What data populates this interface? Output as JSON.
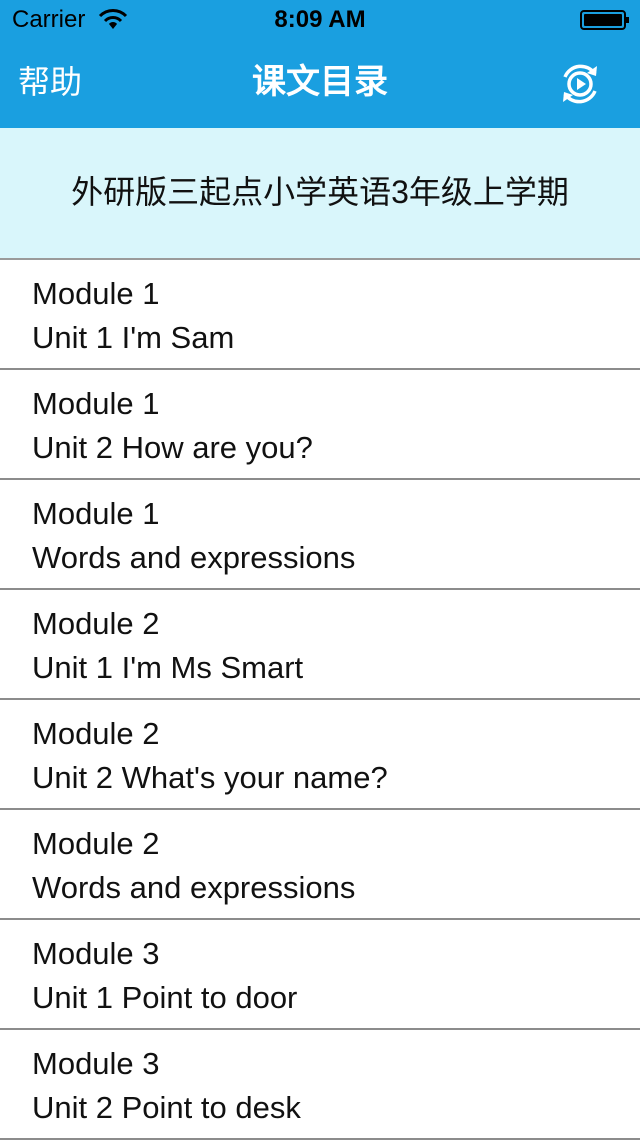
{
  "status_bar": {
    "carrier": "Carrier",
    "time": "8:09 AM",
    "wifi_icon": "wifi-icon",
    "battery_icon": "battery-icon"
  },
  "nav": {
    "help_label": "帮助",
    "title": "课文目录",
    "play_icon": "play-refresh-icon",
    "color": "#1a9fe0"
  },
  "book": {
    "title": "外研版三起点小学英语3年级上学期",
    "background": "#d9f6fb"
  },
  "lessons": [
    {
      "module": "Module 1",
      "unit": "Unit 1 I'm Sam"
    },
    {
      "module": "Module 1",
      "unit": "Unit 2 How are you?"
    },
    {
      "module": "Module 1",
      "unit": "Words and expressions"
    },
    {
      "module": "Module 2",
      "unit": "Unit 1 I'm Ms Smart"
    },
    {
      "module": "Module 2",
      "unit": "Unit 2 What's your name?"
    },
    {
      "module": "Module 2",
      "unit": "Words and expressions"
    },
    {
      "module": "Module 3",
      "unit": "Unit 1 Point to door"
    },
    {
      "module": "Module 3",
      "unit": "Unit 2 Point to desk"
    }
  ]
}
